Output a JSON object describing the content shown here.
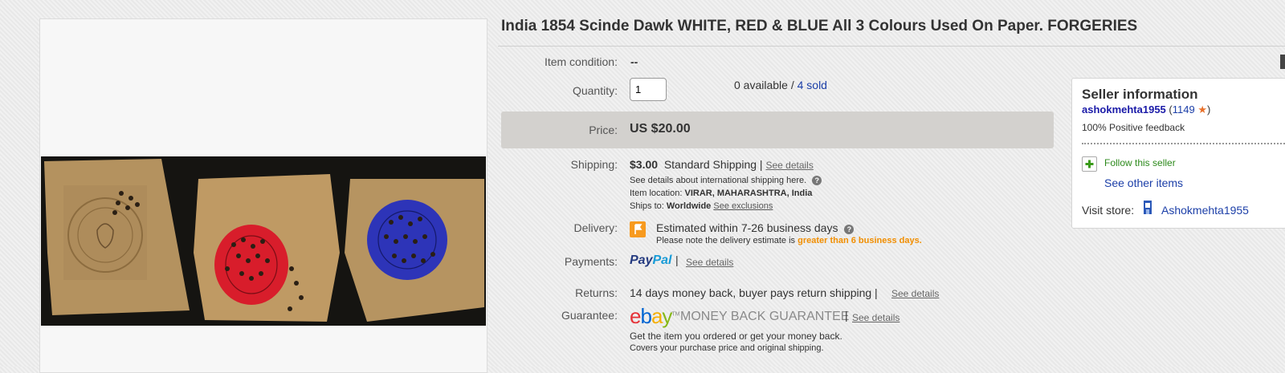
{
  "listing": {
    "title": "India 1854 Scinde Dawk WHITE, RED & BLUE All 3 Colours Used On Paper. FORGERIES"
  },
  "details": {
    "condition_label": "Item condition:",
    "condition_value": "--",
    "quantity_label": "Quantity:",
    "quantity_value": "1",
    "available_text": "0 available /",
    "sold_link": "4 sold",
    "price_label": "Price:",
    "price_value": "US $20.00",
    "shipping_label": "Shipping:",
    "shipping_cost": "$3.00",
    "shipping_method": "Standard Shipping |",
    "shipping_see_details": "See details",
    "shipping_intl_note": "See details about international shipping here.",
    "item_location_label": "Item location:",
    "item_location_value": "VIRAR, MAHARASHTRA, India",
    "ships_to_label": "Ships to:",
    "ships_to_value": "Worldwide",
    "see_exclusions": "See exclusions",
    "delivery_label": "Delivery:",
    "delivery_estimate": "Estimated within 7-26 business days",
    "delivery_note_prefix": "Please note the delivery estimate is",
    "delivery_note_highlight": "greater than 6 business days.",
    "payments_label": "Payments:",
    "paypal_pay": "Pay",
    "paypal_pal": "Pal",
    "payments_see_details": "See details",
    "returns_label": "Returns:",
    "returns_value": "14 days money back, buyer pays return shipping |",
    "returns_see_details": "See details",
    "guarantee_label": "Guarantee:",
    "ebay_e": "e",
    "ebay_b": "b",
    "ebay_a": "a",
    "ebay_y": "y",
    "tm": "TM",
    "money_back": "MONEY BACK GUARANTEE",
    "guarantee_see_details": "See details",
    "guarantee_line1": "Get the item you ordered or get your money back.",
    "guarantee_line2": "Covers your purchase price and original shipping."
  },
  "seller": {
    "heading": "Seller information",
    "username": "ashokmehta1955",
    "feedback_open": "(",
    "feedback_score": "1149",
    "feedback_close": ")",
    "positive": "100% Positive feedback",
    "follow": "Follow this seller",
    "see_other": "See other items",
    "visit_store_label": "Visit store:",
    "store_name": "Ashokmehta1955"
  },
  "colors": {
    "link": "#1c3fa8",
    "orange_note": "#f18e00",
    "price_bar": "#d3d1ce",
    "ebay_red": "#e53238",
    "ebay_blue": "#0064d2",
    "ebay_yellow": "#f5af02",
    "ebay_green": "#86b817"
  }
}
